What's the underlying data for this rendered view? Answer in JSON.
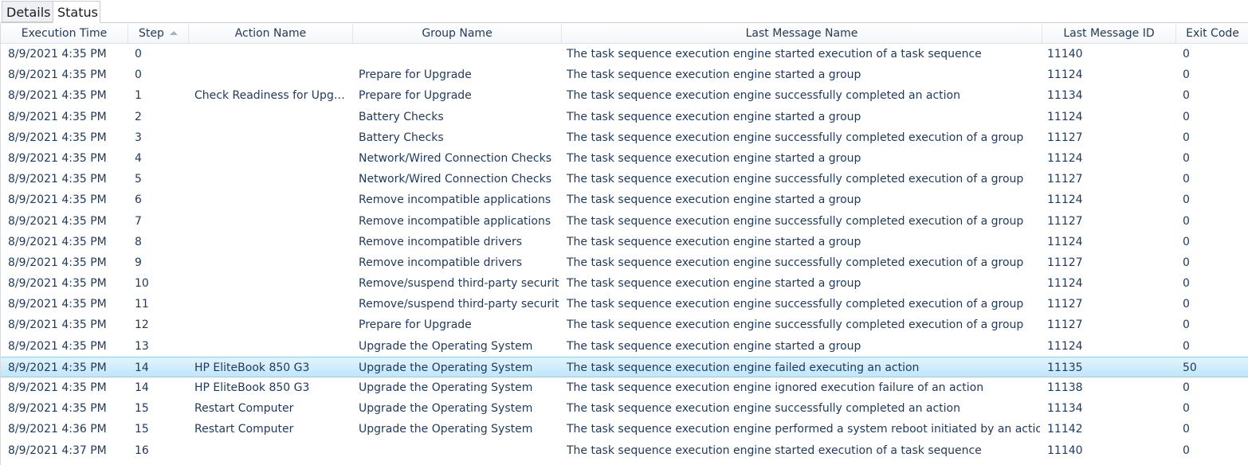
{
  "tabs": [
    {
      "label": "Details"
    },
    {
      "label": "Status"
    }
  ],
  "columns": [
    "Execution Time",
    "Step",
    "Action Name",
    "Group Name",
    "Last Message Name",
    "Last Message ID",
    "Exit Code"
  ],
  "sorted_column": "Step",
  "rows": [
    {
      "time": "8/9/2021 4:35 PM",
      "step": "0",
      "action": "",
      "group": "",
      "message": "The task sequence execution engine started execution of a task sequence",
      "id": "11140",
      "exit": "0"
    },
    {
      "time": "8/9/2021 4:35 PM",
      "step": "0",
      "action": "",
      "group": "Prepare for Upgrade",
      "message": "The task sequence execution engine started a group",
      "id": "11124",
      "exit": "0"
    },
    {
      "time": "8/9/2021 4:35 PM",
      "step": "1",
      "action": "Check Readiness for Upgra...",
      "group": "Prepare for Upgrade",
      "message": "The task sequence execution engine successfully completed an action",
      "id": "11134",
      "exit": "0"
    },
    {
      "time": "8/9/2021 4:35 PM",
      "step": "2",
      "action": "",
      "group": "Battery Checks",
      "message": "The task sequence execution engine started a group",
      "id": "11124",
      "exit": "0"
    },
    {
      "time": "8/9/2021 4:35 PM",
      "step": "3",
      "action": "",
      "group": "Battery Checks",
      "message": "The task sequence execution engine successfully completed execution of a group",
      "id": "11127",
      "exit": "0"
    },
    {
      "time": "8/9/2021 4:35 PM",
      "step": "4",
      "action": "",
      "group": "Network/Wired Connection Checks",
      "message": "The task sequence execution engine started a group",
      "id": "11124",
      "exit": "0"
    },
    {
      "time": "8/9/2021 4:35 PM",
      "step": "5",
      "action": "",
      "group": "Network/Wired Connection Checks",
      "message": "The task sequence execution engine successfully completed execution of a group",
      "id": "11127",
      "exit": "0"
    },
    {
      "time": "8/9/2021 4:35 PM",
      "step": "6",
      "action": "",
      "group": "Remove incompatible applications",
      "message": "The task sequence execution engine started a group",
      "id": "11124",
      "exit": "0"
    },
    {
      "time": "8/9/2021 4:35 PM",
      "step": "7",
      "action": "",
      "group": "Remove incompatible applications",
      "message": "The task sequence execution engine successfully completed execution of a group",
      "id": "11127",
      "exit": "0"
    },
    {
      "time": "8/9/2021 4:35 PM",
      "step": "8",
      "action": "",
      "group": "Remove incompatible drivers",
      "message": "The task sequence execution engine started a group",
      "id": "11124",
      "exit": "0"
    },
    {
      "time": "8/9/2021 4:35 PM",
      "step": "9",
      "action": "",
      "group": "Remove incompatible drivers",
      "message": "The task sequence execution engine successfully completed execution of a group",
      "id": "11127",
      "exit": "0"
    },
    {
      "time": "8/9/2021 4:35 PM",
      "step": "10",
      "action": "",
      "group": "Remove/suspend third-party security",
      "message": "The task sequence execution engine started a group",
      "id": "11124",
      "exit": "0"
    },
    {
      "time": "8/9/2021 4:35 PM",
      "step": "11",
      "action": "",
      "group": "Remove/suspend third-party security",
      "message": "The task sequence execution engine successfully completed execution of a group",
      "id": "11127",
      "exit": "0"
    },
    {
      "time": "8/9/2021 4:35 PM",
      "step": "12",
      "action": "",
      "group": "Prepare for Upgrade",
      "message": "The task sequence execution engine successfully completed execution of a group",
      "id": "11127",
      "exit": "0"
    },
    {
      "time": "8/9/2021 4:35 PM",
      "step": "13",
      "action": "",
      "group": "Upgrade the Operating System",
      "message": "The task sequence execution engine started a group",
      "id": "11124",
      "exit": "0"
    },
    {
      "time": "8/9/2021 4:35 PM",
      "step": "14",
      "action": "HP EliteBook 850 G3",
      "group": "Upgrade the Operating System",
      "message": "The task sequence execution engine failed executing an action",
      "id": "11135",
      "exit": "50",
      "selected": true
    },
    {
      "time": "8/9/2021 4:35 PM",
      "step": "14",
      "action": "HP EliteBook 850 G3",
      "group": "Upgrade the Operating System",
      "message": "The task sequence execution engine ignored execution failure of an action",
      "id": "11138",
      "exit": "0"
    },
    {
      "time": "8/9/2021 4:35 PM",
      "step": "15",
      "action": "Restart Computer",
      "group": "Upgrade the Operating System",
      "message": "The task sequence execution engine successfully completed an action",
      "id": "11134",
      "exit": "0"
    },
    {
      "time": "8/9/2021 4:36 PM",
      "step": "15",
      "action": "Restart Computer",
      "group": "Upgrade the Operating System",
      "message": "The task sequence execution engine performed a system reboot initiated by an action",
      "id": "11142",
      "exit": "0"
    },
    {
      "time": "8/9/2021 4:37 PM",
      "step": "16",
      "action": "",
      "group": "",
      "message": "The task sequence execution engine started execution of a task sequence",
      "id": "11140",
      "exit": "0"
    }
  ]
}
